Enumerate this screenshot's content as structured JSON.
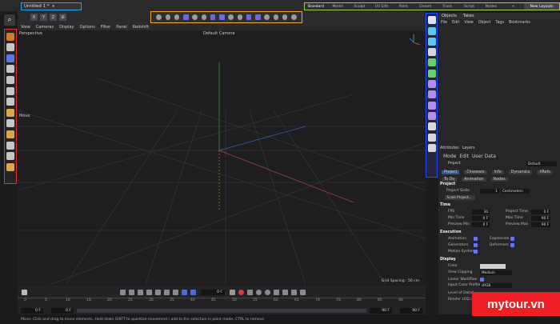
{
  "tab": {
    "title": "Untitled 1 *",
    "add": "+"
  },
  "layouts": {
    "items": [
      "Standard",
      "Model",
      "Sculpt",
      "UV Edit",
      "Paint",
      "Groom",
      "Track",
      "Script",
      "Nodes",
      "+"
    ],
    "active": "Standard",
    "new_layouts": "New Layouts"
  },
  "axis": [
    "X",
    "Y",
    "Z"
  ],
  "viewport_menu": [
    "View",
    "Cameras",
    "Display",
    "Options",
    "Filter",
    "Panel",
    "Redshift"
  ],
  "viewport": {
    "projection": "Perspective",
    "camera": "Default Camera",
    "grid_spacing": "Grid Spacing : 50 cm",
    "tool_label": "Move"
  },
  "timeline": {
    "current_frame": "0 F",
    "ticks": [
      "0",
      "5",
      "10",
      "15",
      "20",
      "25",
      "30",
      "35",
      "40",
      "45",
      "50",
      "55",
      "60",
      "65",
      "70",
      "75",
      "80",
      "85",
      "90"
    ],
    "start": "0 F",
    "start2": "0 F",
    "end": "90 F",
    "end2": "90 F"
  },
  "status": "Move: Click and drag to move elements. Hold down SHIFT to quantize movement / add to the selection in point mode, CTRL to remove.",
  "object_manager": {
    "tabs": [
      "Objects",
      "Takes"
    ],
    "menu": [
      "File",
      "Edit",
      "View",
      "Object",
      "Tags",
      "Bookmarks"
    ]
  },
  "attributes": {
    "tabs": [
      "Attributes",
      "Layers"
    ],
    "menu": [
      "Mode",
      "Edit",
      "User Data"
    ],
    "object": "Project",
    "preset": "Default",
    "subtabs": [
      "Project",
      "Cineware",
      "Info",
      "Dynamics",
      "XRefs",
      "To Do",
      "Animation",
      "Nodes"
    ],
    "section_project": "Project",
    "project_scale_label": "Project Scale",
    "project_scale_value": "1",
    "project_scale_unit": "Centimeters",
    "scale_button": "Scale Project...",
    "section_time": "Time",
    "fps_label": "FPS",
    "fps_value": "30",
    "project_time_label": "Project Time",
    "project_time_value": "0 F",
    "min_time_label": "Min Time",
    "min_time_value": "0 F",
    "max_time_label": "Max Time",
    "max_time_value": "90 F",
    "preview_min_label": "Preview Min",
    "preview_min_value": "0 F",
    "preview_max_label": "Preview Max",
    "preview_max_value": "90 F",
    "section_execution": "Execution",
    "animation": "Animation",
    "expression": "Expression",
    "generators": "Generators",
    "deformers": "Deformers",
    "motion_system": "Motion System",
    "section_display": "Display",
    "color_label": "Color",
    "view_clipping_label": "View Clipping",
    "view_clipping_value": "Medium",
    "linear_workflow": "Linear Workflow",
    "input_color_label": "Input Color Profile",
    "input_color_value": "sRGB",
    "lod_label": "Level of Detail",
    "render_lod": "Render LOD in Editor"
  },
  "watermark": "mytour.vn",
  "colors": {
    "tab_outline": "#1da1f2",
    "layout_outline": "#8fd14f",
    "mode_outline": "#f5a623",
    "left_outline": "#e8322d",
    "right_outline": "#1b4fff",
    "watermark": "#ef1d24"
  }
}
